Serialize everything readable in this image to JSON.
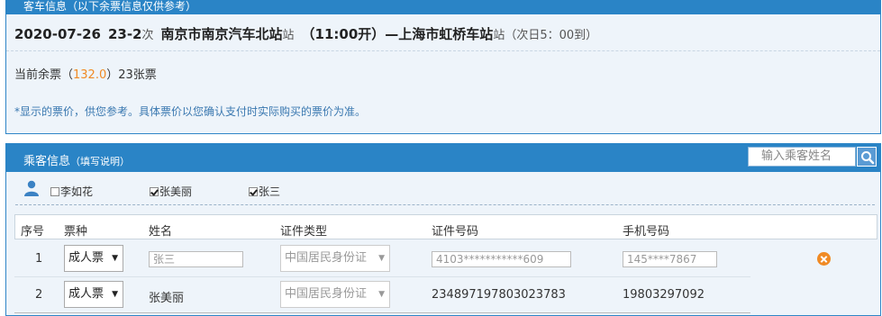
{
  "bus_panel": {
    "header": "客车信息（以下余票信息仅供参考）",
    "date": "2020-07-26",
    "bus_no": "23-2",
    "bus_no_suffix": "次",
    "from_station": "南京市南京汽车北站",
    "from_suffix": "站",
    "depart": "（11:00开）",
    "dash": "—",
    "to_station": "上海市虹桥车站",
    "to_suffix": "站",
    "arrive": "（次日5：00到）",
    "remain_label": "当前余票（",
    "price": "132.0",
    "remain_value": "）23张票",
    "notice": "*显示的票价，供您参考。具体票价以您确认支付时实际购买的票价为准。"
  },
  "passenger_panel": {
    "title": "乘客信息",
    "title_note": "（填写说明）",
    "search": {
      "placeholder": "输入乘客姓名"
    },
    "contacts": [
      {
        "name": "李如花",
        "checked": false
      },
      {
        "name": "张美丽",
        "checked": true
      },
      {
        "name": "张三",
        "checked": true
      }
    ]
  },
  "table": {
    "headers": [
      "序号",
      "票种",
      "姓名",
      "证件类型",
      "证件号码",
      "手机号码"
    ],
    "rows": [
      {
        "index": "1",
        "ticket_type": "成人票",
        "name": "张三",
        "id_type": "中国居民身份证",
        "id_number": "4103***********609",
        "phone": "145****7867"
      },
      {
        "index": "2",
        "ticket_type": "成人票",
        "name": "张美丽",
        "id_type": "中国居民身份证",
        "id_number": "234897197803023783",
        "phone": "19803297092"
      }
    ]
  },
  "icons": {
    "search": "search-icon",
    "person": "person-icon",
    "delete": "close-circle-icon",
    "dropdown": "caret-down-icon"
  },
  "colors": {
    "header_blue": "#2a84c6",
    "panel_bg": "#eef4fa",
    "price_orange": "#f08a24",
    "notice_blue": "#3a78b0"
  }
}
